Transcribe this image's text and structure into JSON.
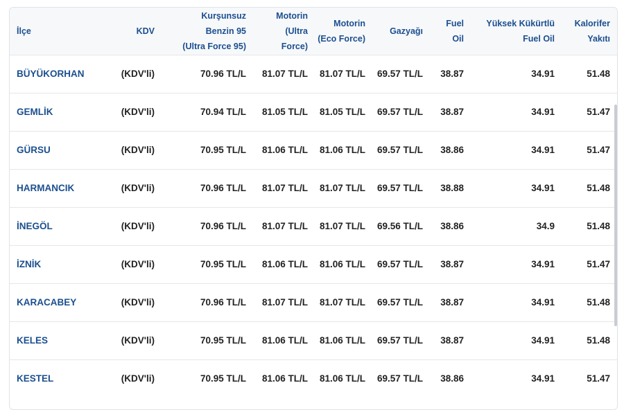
{
  "table": {
    "headers": {
      "ilce": "İlçe",
      "kdv": "KDV",
      "benzin95": [
        "Kurşunsuz",
        "Benzin 95",
        "(Ultra Force 95)"
      ],
      "motorin": [
        "Motorin",
        "(Ultra",
        "Force)"
      ],
      "motorin_eco": [
        "Motorin",
        "(Eco Force)"
      ],
      "gazyagi": "Gazyağı",
      "fuel_oil": [
        "Fuel",
        "Oil"
      ],
      "yuksek_kukurtlu": [
        "Yüksek Kükürtlü",
        "Fuel Oil"
      ],
      "kalorifer": [
        "Kalorifer",
        "Yakıtı"
      ]
    },
    "rows": [
      {
        "ilce": "BÜYÜKORHAN",
        "kdv": "(KDV'li)",
        "benzin95": "70.96 TL/L",
        "motorin": "81.07 TL/L",
        "motorin_eco": "81.07 TL/L",
        "gazyagi": "69.57 TL/L",
        "fuel_oil": "38.87",
        "yuksek_kukurtlu": "34.91",
        "kalorifer": "51.48"
      },
      {
        "ilce": "GEMLİK",
        "kdv": "(KDV'li)",
        "benzin95": "70.94 TL/L",
        "motorin": "81.05 TL/L",
        "motorin_eco": "81.05 TL/L",
        "gazyagi": "69.57 TL/L",
        "fuel_oil": "38.87",
        "yuksek_kukurtlu": "34.91",
        "kalorifer": "51.47"
      },
      {
        "ilce": "GÜRSU",
        "kdv": "(KDV'li)",
        "benzin95": "70.95 TL/L",
        "motorin": "81.06 TL/L",
        "motorin_eco": "81.06 TL/L",
        "gazyagi": "69.57 TL/L",
        "fuel_oil": "38.86",
        "yuksek_kukurtlu": "34.91",
        "kalorifer": "51.47"
      },
      {
        "ilce": "HARMANCIK",
        "kdv": "(KDV'li)",
        "benzin95": "70.96 TL/L",
        "motorin": "81.07 TL/L",
        "motorin_eco": "81.07 TL/L",
        "gazyagi": "69.57 TL/L",
        "fuel_oil": "38.88",
        "yuksek_kukurtlu": "34.91",
        "kalorifer": "51.48"
      },
      {
        "ilce": "İNEGÖL",
        "kdv": "(KDV'li)",
        "benzin95": "70.96 TL/L",
        "motorin": "81.07 TL/L",
        "motorin_eco": "81.07 TL/L",
        "gazyagi": "69.56 TL/L",
        "fuel_oil": "38.86",
        "yuksek_kukurtlu": "34.9",
        "kalorifer": "51.48"
      },
      {
        "ilce": "İZNİK",
        "kdv": "(KDV'li)",
        "benzin95": "70.95 TL/L",
        "motorin": "81.06 TL/L",
        "motorin_eco": "81.06 TL/L",
        "gazyagi": "69.57 TL/L",
        "fuel_oil": "38.87",
        "yuksek_kukurtlu": "34.91",
        "kalorifer": "51.47"
      },
      {
        "ilce": "KARACABEY",
        "kdv": "(KDV'li)",
        "benzin95": "70.96 TL/L",
        "motorin": "81.07 TL/L",
        "motorin_eco": "81.07 TL/L",
        "gazyagi": "69.57 TL/L",
        "fuel_oil": "38.87",
        "yuksek_kukurtlu": "34.91",
        "kalorifer": "51.48"
      },
      {
        "ilce": "KELES",
        "kdv": "(KDV'li)",
        "benzin95": "70.95 TL/L",
        "motorin": "81.06 TL/L",
        "motorin_eco": "81.06 TL/L",
        "gazyagi": "69.57 TL/L",
        "fuel_oil": "38.87",
        "yuksek_kukurtlu": "34.91",
        "kalorifer": "51.48"
      },
      {
        "ilce": "KESTEL",
        "kdv": "(KDV'li)",
        "benzin95": "70.95 TL/L",
        "motorin": "81.06 TL/L",
        "motorin_eco": "81.06 TL/L",
        "gazyagi": "69.57 TL/L",
        "fuel_oil": "38.86",
        "yuksek_kukurtlu": "34.91",
        "kalorifer": "51.47"
      }
    ]
  },
  "colors": {
    "link": "#1b4f8f",
    "text": "#222222",
    "header_bg": "#f7f8fa",
    "border": "#e3e6ea"
  }
}
